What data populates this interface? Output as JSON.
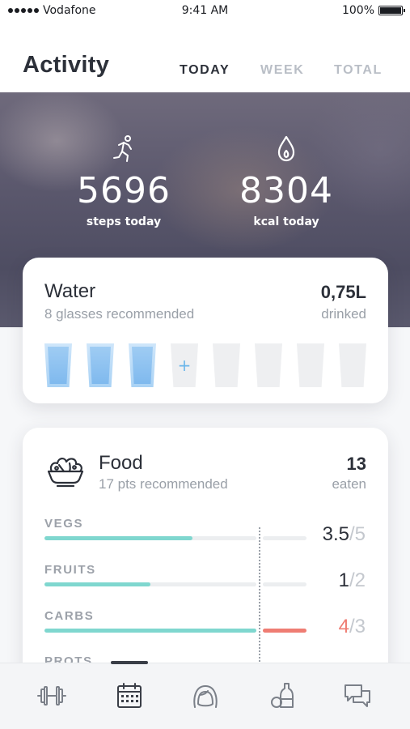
{
  "status_bar": {
    "carrier": "Vodafone",
    "time": "9:41 AM",
    "battery": "100%"
  },
  "header": {
    "title": "Activity",
    "tabs": [
      {
        "label": "TODAY",
        "active": true
      },
      {
        "label": "WEEK",
        "active": false
      },
      {
        "label": "TOTAL",
        "active": false
      }
    ]
  },
  "hero": {
    "steps": {
      "value": "5696",
      "label": "steps today",
      "icon": "running-icon"
    },
    "kcal": {
      "value": "8304",
      "label": "kcal today",
      "icon": "drop-icon"
    }
  },
  "water": {
    "title": "Water",
    "subtitle": "8 glasses recommended",
    "amount": "0,75L",
    "amount_label": "drinked",
    "glasses_filled": 3,
    "glasses_total": 8,
    "add_symbol": "+",
    "colors": {
      "water": "#8cc4f1",
      "empty": "#eeeff1",
      "add": "#6bb6ea"
    }
  },
  "food": {
    "title": "Food",
    "subtitle": "17 pts recommended",
    "total": "13",
    "total_label": "eaten",
    "icon": "salad-bowl-icon",
    "nutrients": [
      {
        "label": "VEGS",
        "eaten": "3.5",
        "target": "5",
        "fraction": 0.7,
        "over": false
      },
      {
        "label": "FRUITS",
        "eaten": "1",
        "target": "2",
        "fraction": 0.5,
        "over": false
      },
      {
        "label": "CARBS",
        "eaten": "4",
        "target": "3",
        "fraction": 1.0,
        "over": true
      },
      {
        "label": "PROTS",
        "eaten": "",
        "target": "",
        "fraction": 0,
        "over": false
      }
    ],
    "colors": {
      "bar": "#7fd7cf",
      "over": "#ef7d73"
    }
  },
  "bottom_nav": {
    "items": [
      {
        "name": "dumbbell-icon",
        "active": false
      },
      {
        "name": "calendar-icon",
        "active": true
      },
      {
        "name": "avatar-face-icon",
        "active": false
      },
      {
        "name": "bottles-icon",
        "active": false
      },
      {
        "name": "chat-icon",
        "active": false
      }
    ]
  }
}
